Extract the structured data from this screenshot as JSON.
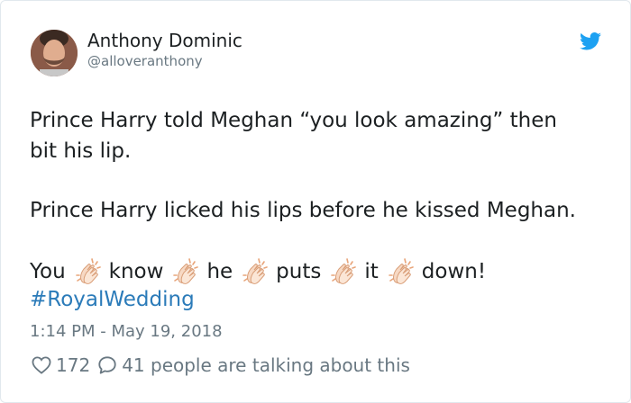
{
  "author": {
    "name": "Anthony Dominic",
    "handle": "@alloveranthony",
    "avatar_icon": "user-avatar"
  },
  "brand": {
    "icon": "twitter-bird-icon",
    "color": "#1da1f2"
  },
  "tweet": {
    "line1": "Prince Harry told Meghan “you look amazing” then",
    "line2": "bit his lip.",
    "line3": "Prince Harry licked his lips before he kissed Meghan.",
    "line4_words": [
      "You",
      "know",
      "he",
      "puts",
      "it",
      "down!"
    ],
    "clap_icon": "clapping-hands-icon",
    "hashtag": "#RoyalWedding"
  },
  "timestamp": "1:14 PM - May 19, 2018",
  "stats": {
    "likes": "172",
    "talking": "41 people are talking about this",
    "like_icon": "heart-icon",
    "reply_icon": "speech-bubble-icon"
  },
  "colors": {
    "text": "#1c2022",
    "muted": "#697882",
    "link": "#2b7bb9"
  }
}
